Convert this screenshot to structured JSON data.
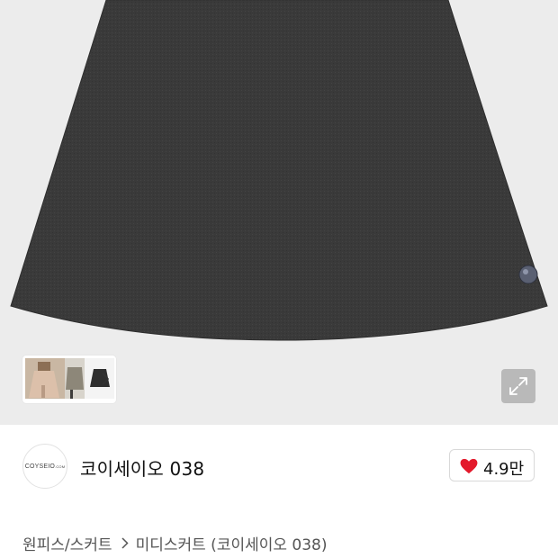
{
  "gallery": {
    "expand_icon": "expand-arrows-icon",
    "thumbnail_next_icon": "chevron-right-icon"
  },
  "brand": {
    "logo_text": "COYSEIO",
    "logo_suffix": ".COM",
    "name": "코이세이오 038"
  },
  "likes": {
    "icon": "heart-icon",
    "count": "4.9만",
    "color": "#e3192b"
  },
  "breadcrumb": {
    "category": "원피스/스커트",
    "separator_icon": "chevron-right-icon",
    "subcategory": "미디스커트 (코이세이오 038)"
  }
}
